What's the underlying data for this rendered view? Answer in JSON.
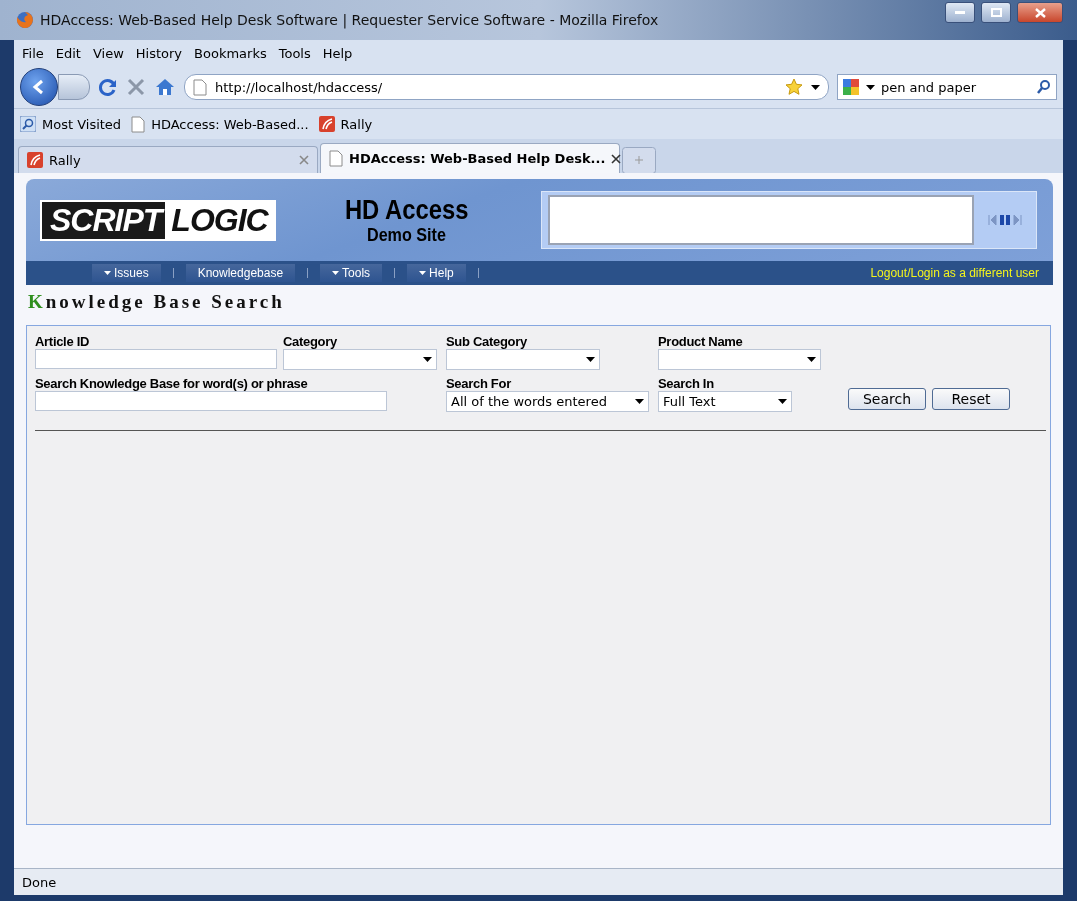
{
  "window": {
    "title": "HDAccess: Web-Based Help Desk Software | Requester Service Software - Mozilla Firefox"
  },
  "menu": [
    {
      "label": "File"
    },
    {
      "label": "Edit"
    },
    {
      "label": "View"
    },
    {
      "label": "History"
    },
    {
      "label": "Bookmarks"
    },
    {
      "label": "Tools"
    },
    {
      "label": "Help"
    }
  ],
  "navigation": {
    "url": "http://localhost/hdaccess/",
    "search": "pen and paper"
  },
  "bookmarks": [
    {
      "label": "Most Visited",
      "kind": "search"
    },
    {
      "label": "HDAccess: Web-Based...",
      "kind": "page"
    },
    {
      "label": "Rally",
      "kind": "rally"
    }
  ],
  "tabs": [
    {
      "label": "Rally",
      "kind": "rally",
      "selected": false
    },
    {
      "label": "HDAccess: Web-Based Help Desk...",
      "kind": "page",
      "selected": true
    }
  ],
  "site": {
    "logo_left": "SCRIPT",
    "logo_right": "LOGIC",
    "title": "HD Access",
    "subtitle": "Demo Site",
    "nav": [
      {
        "label": "Issues",
        "dropdown": true
      },
      {
        "label": "Knowledgebase",
        "dropdown": false
      },
      {
        "label": "Tools",
        "dropdown": true
      },
      {
        "label": "Help",
        "dropdown": true
      }
    ],
    "user_link": "Logout/Login as a different user"
  },
  "heading": "Knowledge Base Search",
  "form": {
    "fields": [
      {
        "label": "Article ID",
        "kind": "text"
      },
      {
        "label": "Category",
        "kind": "select"
      },
      {
        "label": "Sub Category",
        "kind": "select"
      },
      {
        "label": "Product Name",
        "kind": "select"
      },
      {
        "label": "Search Knowledge Base for word(s) or phrase",
        "kind": "text"
      },
      {
        "label": "Search For",
        "kind": "select",
        "value": "All of the words entered"
      },
      {
        "label": "Search In",
        "kind": "select",
        "value": "Full Text"
      }
    ],
    "buttons": [
      {
        "label": "Search"
      },
      {
        "label": "Reset"
      }
    ]
  },
  "status_bar": {
    "text": "Done"
  }
}
